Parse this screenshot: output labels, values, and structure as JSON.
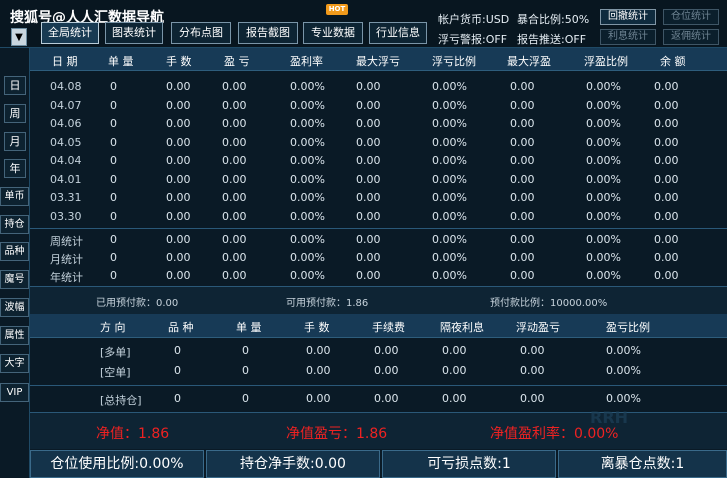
{
  "title": "搜狐号@人人汇数据导航",
  "title_dropdown": "▼",
  "hot_badge": "HOT",
  "toolbar": {
    "buttons": [
      "全局统计",
      "图表统计",
      "分布点图",
      "报告截图",
      "专业数据",
      "行业信息"
    ]
  },
  "status": {
    "currency": "帐户货币:USD",
    "margin_ratio": "暴合比例:50%",
    "float_alert": "浮亏警报:OFF",
    "report_push": "报告推送:OFF"
  },
  "right_buttons": [
    {
      "label": "回撤统计",
      "enabled": true
    },
    {
      "label": "仓位统计",
      "enabled": false
    },
    {
      "label": "利息统计",
      "enabled": false
    },
    {
      "label": "返佣统计",
      "enabled": false
    }
  ],
  "sidebar": [
    "日",
    "周",
    "月",
    "年",
    "单币",
    "持仓",
    "品种",
    "魔号",
    "波幅",
    "属性",
    "大字",
    "VIP"
  ],
  "table1": {
    "headers": [
      "日 期",
      "单 量",
      "手 数",
      "盈 亏",
      "盈利率",
      "最大浮亏",
      "浮亏比例",
      "最大浮盈",
      "浮盈比例",
      "余 额"
    ],
    "rows": [
      [
        "04.08",
        "0",
        "0.00",
        "0.00",
        "0.00%",
        "0.00",
        "0.00%",
        "0.00",
        "0.00%",
        "0.00"
      ],
      [
        "04.07",
        "0",
        "0.00",
        "0.00",
        "0.00%",
        "0.00",
        "0.00%",
        "0.00",
        "0.00%",
        "0.00"
      ],
      [
        "04.06",
        "0",
        "0.00",
        "0.00",
        "0.00%",
        "0.00",
        "0.00%",
        "0.00",
        "0.00%",
        "0.00"
      ],
      [
        "04.05",
        "0",
        "0.00",
        "0.00",
        "0.00%",
        "0.00",
        "0.00%",
        "0.00",
        "0.00%",
        "0.00"
      ],
      [
        "04.04",
        "0",
        "0.00",
        "0.00",
        "0.00%",
        "0.00",
        "0.00%",
        "0.00",
        "0.00%",
        "0.00"
      ],
      [
        "04.01",
        "0",
        "0.00",
        "0.00",
        "0.00%",
        "0.00",
        "0.00%",
        "0.00",
        "0.00%",
        "0.00"
      ],
      [
        "03.31",
        "0",
        "0.00",
        "0.00",
        "0.00%",
        "0.00",
        "0.00%",
        "0.00",
        "0.00%",
        "0.00"
      ],
      [
        "03.30",
        "0",
        "0.00",
        "0.00",
        "0.00%",
        "0.00",
        "0.00%",
        "0.00",
        "0.00%",
        "0.00"
      ]
    ],
    "summary_rows": [
      [
        "周统计",
        "0",
        "0.00",
        "0.00",
        "0.00%",
        "0.00",
        "0.00%",
        "0.00",
        "0.00%",
        "0.00"
      ],
      [
        "月统计",
        "0",
        "0.00",
        "0.00",
        "0.00%",
        "0.00",
        "0.00%",
        "0.00",
        "0.00%",
        "0.00"
      ],
      [
        "年统计",
        "0",
        "0.00",
        "0.00",
        "0.00%",
        "0.00",
        "0.00%",
        "0.00",
        "0.00%",
        "0.00"
      ]
    ]
  },
  "margin_info": {
    "used": "已用预付款：0.00",
    "available": "可用预付款：1.86",
    "ratio": "预付款比例：10000.00%"
  },
  "table2": {
    "headers": [
      "方 向",
      "品 种",
      "单 量",
      "手 数",
      "手续费",
      "隔夜利息",
      "浮动盈亏",
      "盈亏比例"
    ],
    "rows": [
      [
        "[多单]",
        "0",
        "0",
        "0.00",
        "0.00",
        "0.00",
        "0.00",
        "0.00%"
      ],
      [
        "[空单]",
        "0",
        "0",
        "0.00",
        "0.00",
        "0.00",
        "0.00",
        "0.00%"
      ]
    ],
    "total": [
      "[总持仓]",
      "0",
      "0",
      "0.00",
      "0.00",
      "0.00",
      "0.00",
      "0.00%"
    ]
  },
  "net": {
    "value": "净值：1.86",
    "profit": "净值盈亏：1.86",
    "rate": "净值盈利率：0.00%"
  },
  "footer": [
    "仓位使用比例:0.00%",
    "持仓净手数:0.00",
    "可亏损点数:1",
    "离暴仓点数:1"
  ],
  "watermark": "RRH",
  "colors": {
    "accent": "#173a56",
    "negative": "#ee2222",
    "hot": "#f19a1b"
  }
}
